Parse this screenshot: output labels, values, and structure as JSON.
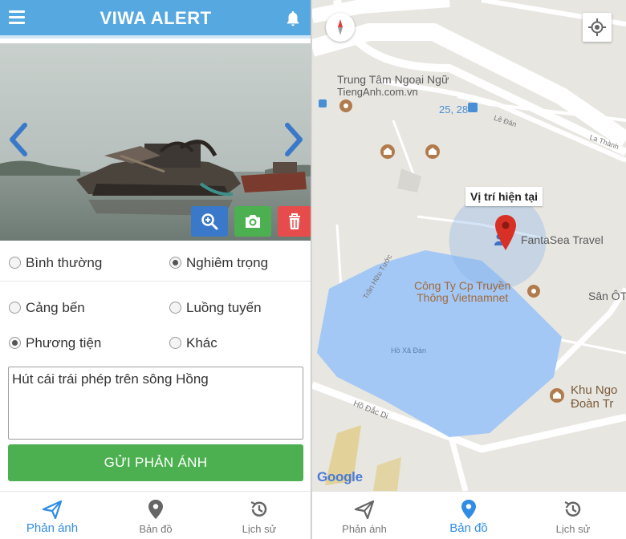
{
  "colors": {
    "header": "#56a8e0",
    "submit": "#4cb050",
    "active_nav": "#2f8de4",
    "water": "#a4c8f5",
    "pin": "#d93025"
  },
  "header": {
    "title": "VIWA ALERT",
    "menu_icon": "hamburger-icon",
    "bell_icon": "bell-icon"
  },
  "photo": {
    "prev_icon": "chevron-left-icon",
    "next_icon": "chevron-right-icon"
  },
  "tools": {
    "zoom_icon": "zoom-in-icon",
    "camera_icon": "camera-icon",
    "delete_icon": "trash-icon"
  },
  "severity": [
    {
      "label": "Bình thường",
      "checked": false
    },
    {
      "label": "Nghiêm trọng",
      "checked": true
    }
  ],
  "categories": [
    {
      "label": "Cảng bến",
      "checked": false
    },
    {
      "label": "Luồng tuyến",
      "checked": false
    },
    {
      "label": "Phương tiện",
      "checked": true
    },
    {
      "label": "Khác",
      "checked": false
    }
  ],
  "report": {
    "text": "Hút cái trái phép trên sông Hồng",
    "submit_label": "GỬI PHẢN ÁNH"
  },
  "left_nav": [
    {
      "label": "Phản ánh",
      "icon": "send-icon",
      "active": true
    },
    {
      "label": "Bản đồ",
      "icon": "map-pin-icon",
      "active": false
    },
    {
      "label": "Lịch sử",
      "icon": "history-icon",
      "active": false
    }
  ],
  "right_nav": [
    {
      "label": "Phản ánh",
      "icon": "send-icon",
      "active": false
    },
    {
      "label": "Bản đồ",
      "icon": "map-pin-icon",
      "active": true
    },
    {
      "label": "Lịch sử",
      "icon": "history-icon",
      "active": false
    }
  ],
  "map": {
    "tooltip": "Vị trí hiện tại",
    "poi_center_line1": "Trung Tâm Ngoại Ngữ",
    "poi_center_line2": "TiengAnh.com.vn",
    "bus_stop": "25, 28",
    "street_la_dan": "Lê Đán",
    "street_la_thanh": "La Thành",
    "street_tran_huu_tuoc": "Trần Hữu Tước",
    "poi_fantasea": "FantaSea Travel",
    "poi_vnn_line1": "Công Ty Cp Truyền",
    "poi_vnn_line2": "Thông Vietnamnet",
    "poi_san": "Sân ÔT",
    "lake": "Hồ Xã Đàn",
    "street_ho_dac_di": "Hồ Đắc Di",
    "poi_khu_line1": "Khu Ngo",
    "poi_khu_line2": "Đoàn Tr",
    "logo": "Google",
    "compass_icon": "compass-icon",
    "locate_icon": "crosshair-icon"
  }
}
